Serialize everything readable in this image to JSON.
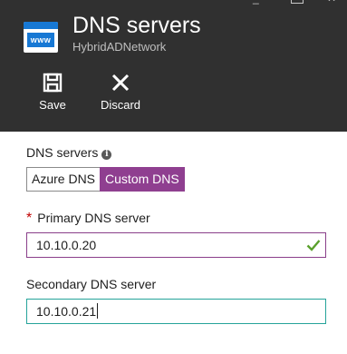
{
  "header": {
    "title": "DNS servers",
    "subtitle": "HybridADNetwork",
    "icon_text": "www",
    "commands": {
      "save_label": "Save",
      "discard_label": "Discard"
    }
  },
  "dns_servers": {
    "label": "DNS servers",
    "info_glyph": "i",
    "options": [
      "Azure DNS",
      "Custom DNS"
    ],
    "selected": "Custom DNS"
  },
  "primary": {
    "required_mark": "*",
    "label": "Primary DNS server",
    "value": "10.10.0.20",
    "valid": true
  },
  "secondary": {
    "label": "Secondary DNS server",
    "value": "10.10.0.21"
  },
  "colors": {
    "header_bg": "#303030",
    "accent_purple": "#8f3f90",
    "focus_teal": "#25a39a",
    "valid_green": "#5aa02c",
    "required_red": "#c00000"
  }
}
